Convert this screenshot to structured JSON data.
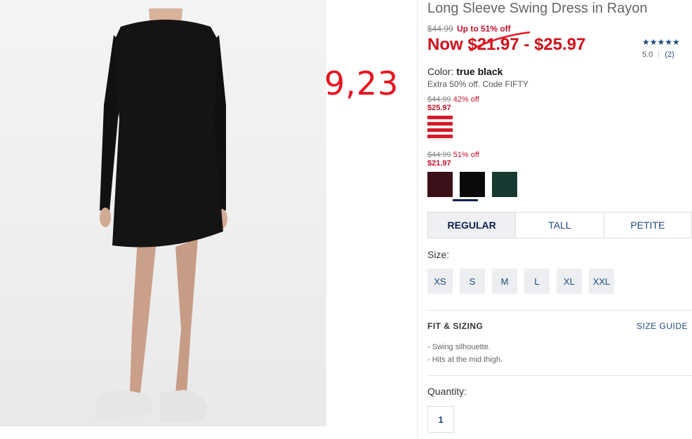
{
  "product": {
    "title": "Long Sleeve Swing Dress in Rayon",
    "original_price": "$44.99",
    "discount_text": "Up to 51% off",
    "now_label": "Now",
    "now_low": "$21.97",
    "now_sep": " - ",
    "now_high": "$25.97"
  },
  "rating": {
    "stars": "★★★★★",
    "score": "5.0",
    "count": "(2)"
  },
  "annotation": "9,23",
  "color": {
    "label": "Color:",
    "value": "true black",
    "promo": "Extra 50% off. Code FIFTY"
  },
  "price_groups": [
    {
      "original": "$44.99",
      "discount": "42% off",
      "now": "$25.97"
    },
    {
      "original": "$44.99",
      "discount": "51% off",
      "now": "$21.97"
    }
  ],
  "swatches": [
    {
      "name": "red-stripe",
      "color": "#d61a2a"
    },
    {
      "name": "burgundy",
      "color": "#3d1019"
    },
    {
      "name": "black",
      "color": "#0a0a0a"
    },
    {
      "name": "dark-green",
      "color": "#163a32"
    }
  ],
  "fit_tabs": [
    "REGULAR",
    "TALL",
    "PETITE"
  ],
  "size_label": "Size:",
  "sizes": [
    "XS",
    "S",
    "M",
    "L",
    "XL",
    "XXL"
  ],
  "fit_sizing": {
    "heading": "FIT & SIZING",
    "guide_link": "SIZE GUIDE",
    "bullets": [
      "- Swing silhouette.",
      "- Hits at the mid thigh."
    ]
  },
  "quantity": {
    "label": "Quantity:",
    "value": "1"
  },
  "colors": {
    "sale_red": "#d0101b",
    "link_blue": "#1c4a80",
    "annotation_red": "#e8141f"
  }
}
